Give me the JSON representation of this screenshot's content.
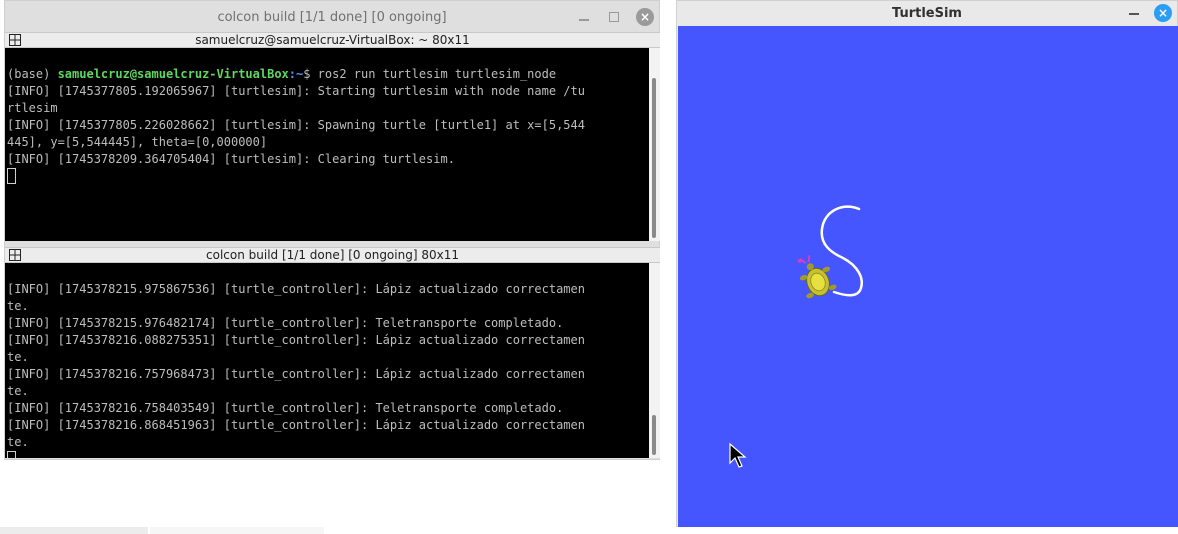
{
  "terminal": {
    "title": "colcon build [1/1 done] [0 ongoing]",
    "top_pane": {
      "header": "samuelcruz@samuelcruz-VirtualBox: ~ 80x11",
      "prompt_base": "(base) ",
      "prompt_user": "samuelcruz@samuelcruz-VirtualBox",
      "prompt_path": ":~",
      "prompt_cmd": "$ ros2 run turtlesim turtlesim_node",
      "lines": [
        "[INFO] [1745377805.192065967] [turtlesim]: Starting turtlesim with node name /tu",
        "rtlesim",
        "[INFO] [1745377805.226028662] [turtlesim]: Spawning turtle [turtle1] at x=[5,544",
        "445], y=[5,544445], theta=[0,000000]",
        "[INFO] [1745378209.364705404] [turtlesim]: Clearing turtlesim."
      ]
    },
    "bottom_pane": {
      "header": "colcon build [1/1 done] [0 ongoing] 80x11",
      "lines": [
        "[INFO] [1745378215.975867536] [turtle_controller]: Lápiz actualizado correctamen",
        "te.",
        "[INFO] [1745378215.976482174] [turtle_controller]: Teletransporte completado.",
        "[INFO] [1745378216.088275351] [turtle_controller]: Lápiz actualizado correctamen",
        "te.",
        "[INFO] [1745378216.757968473] [turtle_controller]: Lápiz actualizado correctamen",
        "te.",
        "[INFO] [1745378216.758403549] [turtle_controller]: Teletransporte completado.",
        "[INFO] [1745378216.868451963] [turtle_controller]: Lápiz actualizado correctamen",
        "te."
      ]
    }
  },
  "turtlesim": {
    "title": "TurtleSim",
    "background_color": "#4556ff",
    "trail_color": "#ffffff"
  },
  "icons": {
    "terminal_close": "close-icon",
    "sim_close": "close-icon",
    "pane_menu": "split-pane-icon",
    "cursor": "mouse-pointer-icon"
  }
}
